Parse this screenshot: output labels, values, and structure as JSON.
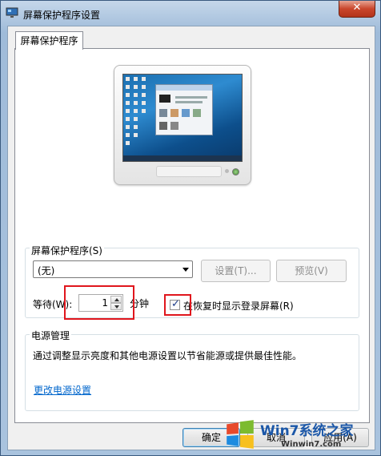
{
  "window": {
    "title": "屏幕保护程序设置",
    "close_label": "✕"
  },
  "tab": {
    "label": "屏幕保护程序"
  },
  "screensaver": {
    "group_label": "屏幕保护程序(S)",
    "selected": "(无)",
    "settings_button": "设置(T)...",
    "preview_button": "预览(V)",
    "wait_label": "等待(W):",
    "wait_value": "1",
    "minutes_label": "分钟",
    "resume_checkbox_label": "在恢复时显示登录屏幕(R)",
    "resume_checked": true
  },
  "power": {
    "group_label": "电源管理",
    "description": "通过调整显示亮度和其他电源设置以节省能源或提供最佳性能。",
    "link": "更改电源设置"
  },
  "buttons": {
    "ok": "确定",
    "cancel": "取消",
    "apply": "应用(A)"
  },
  "watermark": {
    "brand": "Win7系统之家",
    "url": "Winwin7.com"
  },
  "colors": {
    "highlight_box": "#e0161d",
    "link": "#0066cc"
  }
}
